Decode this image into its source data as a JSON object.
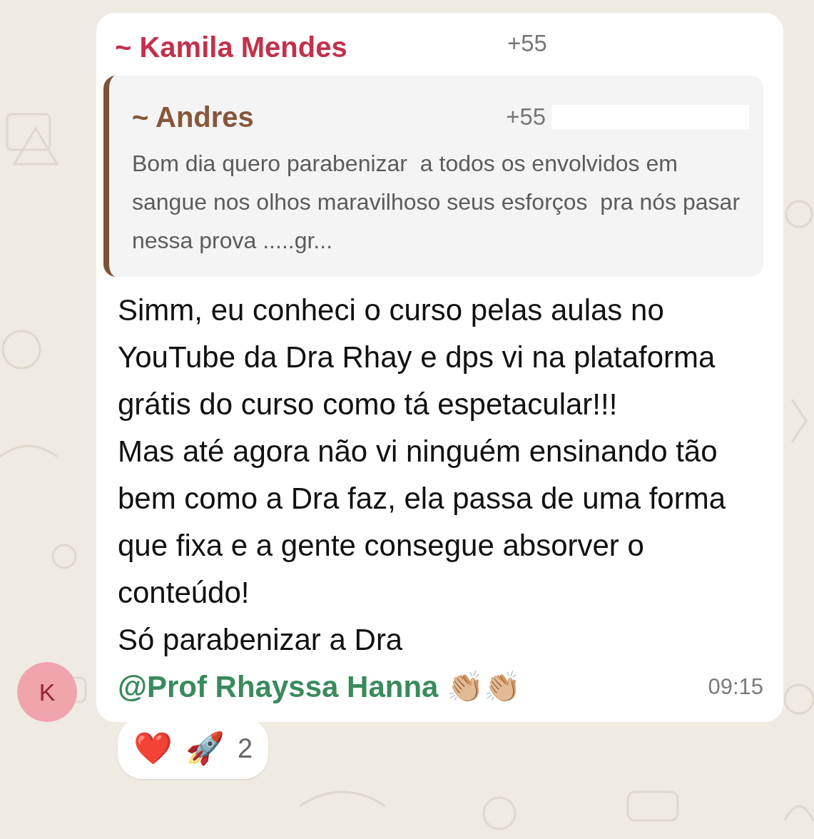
{
  "message": {
    "sender": "~ Kamila Mendes",
    "sender_phone": "+55",
    "avatar_letter": "K",
    "quote": {
      "author": "~ Andres",
      "phone": "+55",
      "text": "Bom dia quero parabenizar  a todos os envolvidos em sangue nos olhos maravilhoso seus esforços  pra nós pasar nessa prova .....gr..."
    },
    "paragraphs": [
      "Simm, eu conheci o curso pelas aulas no YouTube da Dra Rhay e dps vi na plataforma grátis do curso como tá espetacular!!!",
      "Mas até agora não vi ninguém ensinando tão bem como a Dra faz, ela passa de uma forma que fixa e a gente consegue absorver o conteúdo!"
    ],
    "closing": {
      "text": "Só parabenizar a Dra",
      "mention": "@Prof Rhayssa Hanna",
      "emoji": "👏🏼👏🏼"
    },
    "time": "09:15",
    "reactions": {
      "emojis": [
        "❤️",
        "🚀"
      ],
      "count": "2"
    }
  }
}
